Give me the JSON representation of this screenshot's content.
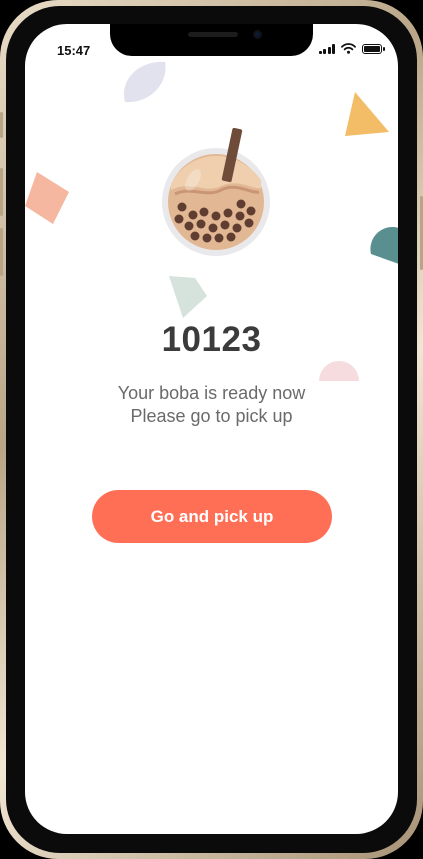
{
  "status_bar": {
    "time": "15:47",
    "icons": [
      "cellular-signal-icon",
      "wifi-icon",
      "battery-icon"
    ]
  },
  "order": {
    "number": "10123",
    "message_line1": "Your boba is ready now",
    "message_line2": "Please go to pick up"
  },
  "actions": {
    "pickup_label": "Go and pick up"
  },
  "colors": {
    "accent": "#ff6f56",
    "heading": "#3b3b3b",
    "body_text": "#6a6a6a"
  }
}
